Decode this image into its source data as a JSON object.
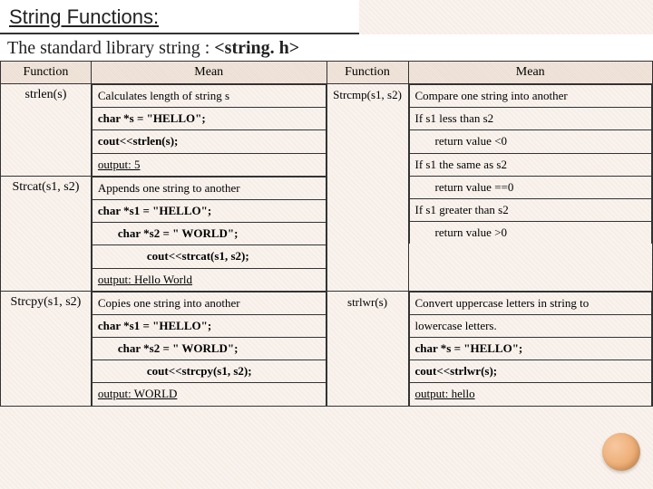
{
  "title": "String Functions:",
  "subtitle_prefix": "The standard library string : ",
  "subtitle_emph": "<string. h>",
  "headers": {
    "function": "Function",
    "mean": "Mean"
  },
  "left": {
    "strlen": {
      "name": "strlen(s)",
      "rows": [
        "Calculates length of string s",
        "char *s = \"HELLO\";",
        "cout<<strlen(s);",
        "output: 5"
      ]
    },
    "strcat": {
      "name": "Strcat(s1, s2)",
      "rows": [
        "Appends one string to another",
        "char *s1 = \"HELLO\";",
        "char *s2 = \" WORLD\";",
        "cout<<strcat(s1, s2);",
        "output: Hello World"
      ]
    },
    "strcpy": {
      "name": "Strcpy(s1, s2)",
      "rows": [
        "Copies one string into another",
        "char *s1 = \"HELLO\";",
        "char *s2 = \" WORLD\";",
        "cout<<strcpy(s1, s2);",
        "output: WORLD"
      ]
    }
  },
  "right": {
    "strcmp": {
      "name": "Strcmp(s1, s2)",
      "rows": [
        "Compare one string into another",
        "If s1 less than s2",
        "return value <0",
        "If s1 the same as s2",
        "return value ==0",
        "If s1 greater than s2",
        "return value >0"
      ]
    },
    "strlwr": {
      "name": "strlwr(s)",
      "rows": [
        "Convert uppercase letters in string to",
        "lowercase letters.",
        "char *s = \"HELLO\";",
        "cout<<strlwr(s);",
        "output: hello"
      ]
    }
  }
}
